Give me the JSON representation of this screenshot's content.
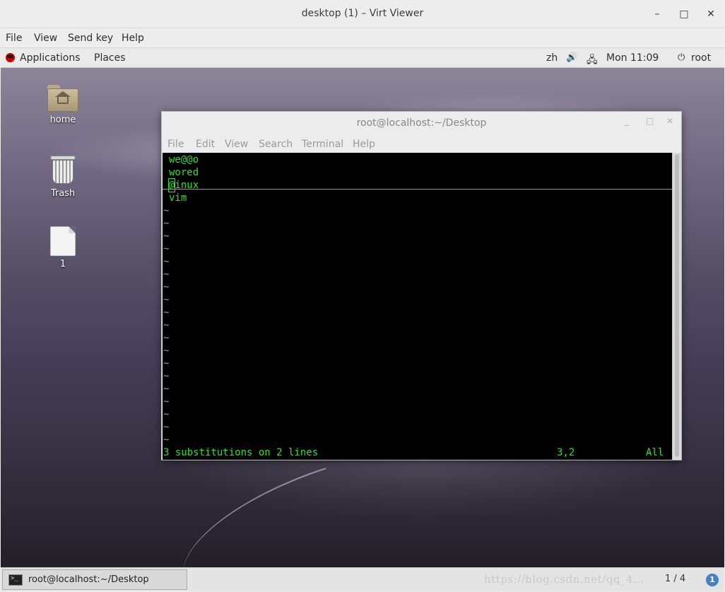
{
  "viewer": {
    "title": "desktop (1) – Virt Viewer",
    "menu": [
      "File",
      "View",
      "Send key",
      "Help"
    ],
    "controls": {
      "minimize": "–",
      "maximize": "□",
      "close": "✕"
    }
  },
  "top_panel": {
    "applications": "Applications",
    "places": "Places",
    "input_method": "zh",
    "volume_icon": "🔊",
    "network_icon": "🖧",
    "clock": "Mon 11:09",
    "user_icon": "⏻",
    "user": "root"
  },
  "desktop_icons": [
    {
      "label": "home",
      "icon": "home-folder-icon"
    },
    {
      "label": "Trash",
      "icon": "trash-icon"
    },
    {
      "label": "1",
      "icon": "file-icon"
    }
  ],
  "terminal": {
    "title": "root@localhost:~/Desktop",
    "controls": {
      "minimize": "_",
      "maximize": "□",
      "close": "✕"
    },
    "menu": [
      "File",
      "Edit",
      "View",
      "Search",
      "Terminal",
      "Help"
    ],
    "lines": [
      "we@@o",
      "wored",
      "@inux",
      "vim"
    ],
    "cursor_line": 3,
    "tilde": "~",
    "status_message": "3 substitutions on 2 lines",
    "status_position": "3,2",
    "status_scroll": "All"
  },
  "taskbar": {
    "task_label": "root@localhost:~/Desktop",
    "watermark": "https://blog.csdn.net/qq_4...",
    "workspace": "1 / 4",
    "notifications": "1"
  }
}
